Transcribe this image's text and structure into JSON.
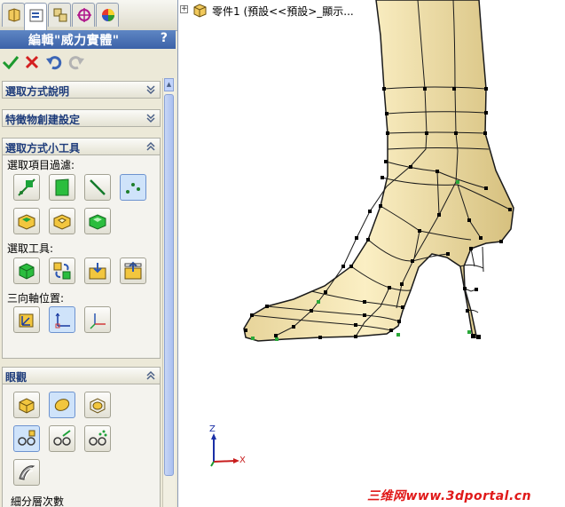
{
  "panel": {
    "title": "編輯\"威力實體\"",
    "help": "?",
    "tabs": [
      "feature-manager-icon",
      "property-manager-icon",
      "configuration-manager-icon",
      "dimxpert-icon",
      "display-manager-icon"
    ],
    "sections": {
      "selection_desc": {
        "label": "選取方式說明"
      },
      "feature_settings": {
        "label": "特徵物創建設定"
      },
      "selection_tools": {
        "label": "選取方式小工具",
        "filter_label": "選取項目過濾:",
        "tool_label": "選取工具:",
        "triad_label": "三向軸位置:"
      },
      "view": {
        "label": "眼觀",
        "subdiv_label": "細分層次數"
      }
    }
  },
  "tree": {
    "text": "零件1 (預設<<預設>_顯示..."
  },
  "triad": {
    "x": "X",
    "z": "Z"
  },
  "watermark": {
    "text": "三维网www.3dportal.cn"
  },
  "colors": {
    "accent": "#3c62a8",
    "model": "#f6e6ad",
    "wire": "#1a1a1a",
    "node": "#000000",
    "wm": "#e01919"
  }
}
